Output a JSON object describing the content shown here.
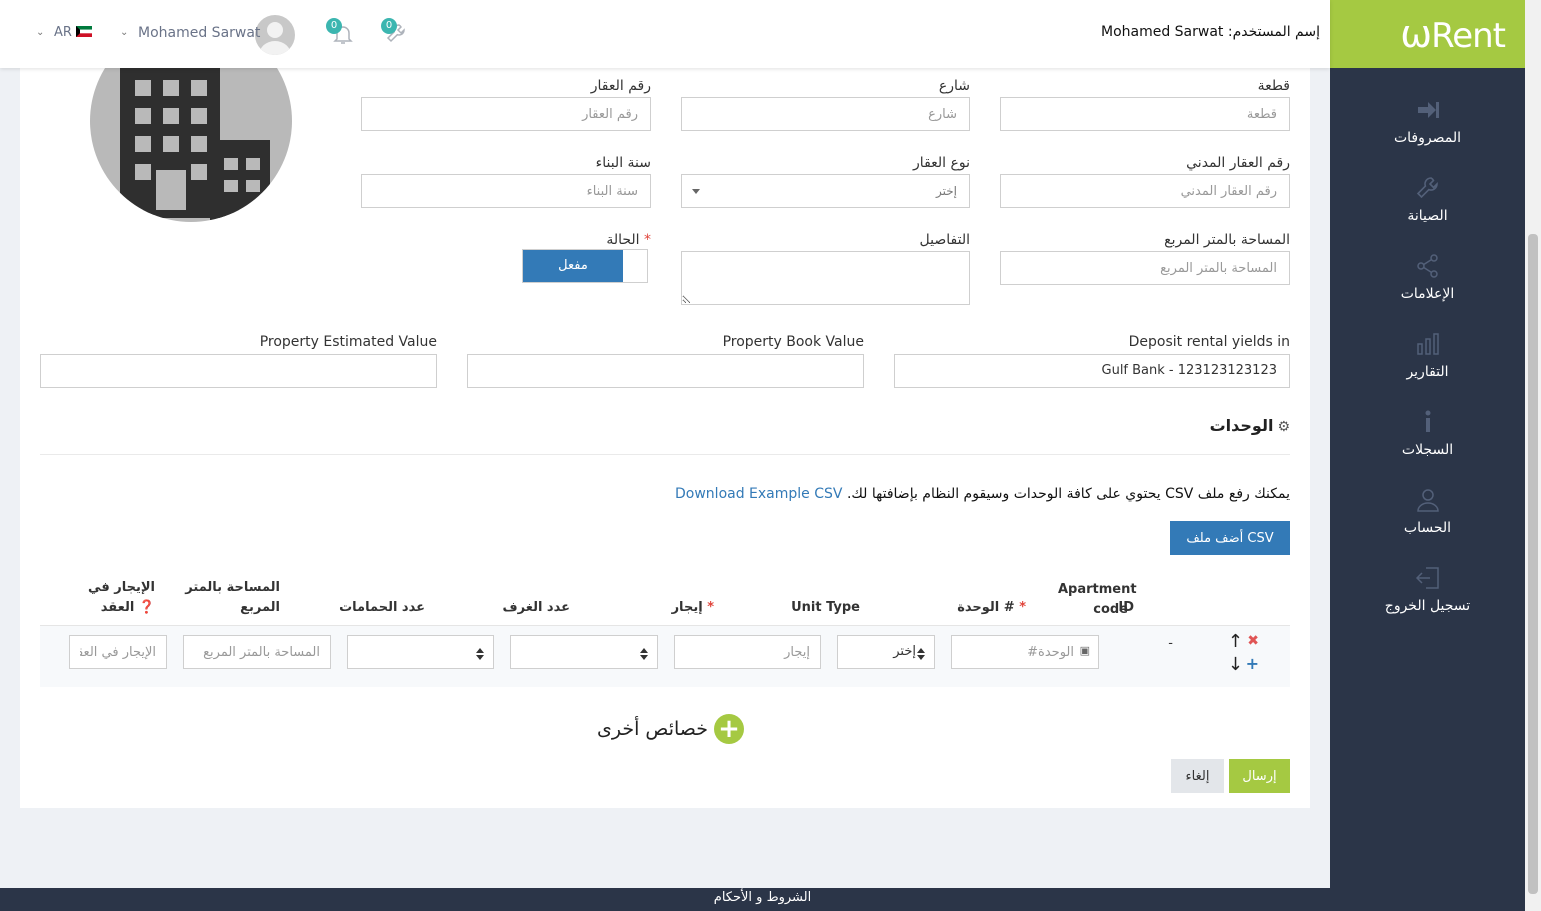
{
  "brand": {
    "name": "Rent",
    "accent_color": "#a5c942",
    "primary_color": "#337ab7",
    "sidebar_color": "#2b3548"
  },
  "header": {
    "username_label": "إسم المستخدم:",
    "username_value": "Mohamed Sarwat",
    "maintenance_count": "0",
    "notifications_count": "0",
    "user_display": "Mohamed Sarwat",
    "language": "AR"
  },
  "sidebar": {
    "items": [
      {
        "label": "المصروفات",
        "icon": "sign-in-icon"
      },
      {
        "label": "الصيانة",
        "icon": "wrench-icon"
      },
      {
        "label": "الإعلامات",
        "icon": "share-icon"
      },
      {
        "label": "التقارير",
        "icon": "bar-chart-icon"
      },
      {
        "label": "السجلات",
        "icon": "info-icon"
      },
      {
        "label": "الحساب",
        "icon": "user-icon"
      },
      {
        "label": "تسجيل الخروج",
        "icon": "sign-out-icon"
      }
    ]
  },
  "form": {
    "block_label": "قطعة",
    "block_placeholder": "قطعة",
    "street_label": "شارع",
    "street_placeholder": "شارع",
    "property_no_label": "رقم العقار",
    "property_no_placeholder": "رقم العقار",
    "civil_no_label": "رقم العقار المدني",
    "civil_no_placeholder": "رقم العقار المدني",
    "property_type_label": "نوع العقار",
    "property_type_value": "إختر",
    "build_year_label": "سنة البناء",
    "build_year_placeholder": "سنة البناء",
    "area_label": "المساحة بالمتر المربع",
    "area_placeholder": "المساحة بالمتر المربع",
    "details_label": "التفاصيل",
    "status_label": "الحالة",
    "required_mark": "*",
    "status_value": "مفعل",
    "deposit_label": "Deposit rental yields in",
    "deposit_value": "Gulf Bank - 123123123123",
    "book_value_label": "Property Book Value",
    "estimated_value_label": "Property Estimated Value"
  },
  "units": {
    "title": "الوحدات",
    "csv_text": "يمكنك رفع ملف CSV يحتوي على كافة الوحدات وسيقوم النظام بإضافتها لك.",
    "csv_link": "Download Example CSV",
    "add_csv_button": "أضف ملف CSV",
    "columns": {
      "id": "ID",
      "apartment_code": "Apartment code",
      "unit_no": "الوحدة #",
      "unit_type": "Unit Type",
      "rent": "إيجار",
      "rooms": "عدد الغرف",
      "bathrooms": "عدد الحمامات",
      "area": "المساحة بالمتر المربع",
      "contract_rent": "الإيجار في العقد"
    },
    "row": {
      "id": "-",
      "unit_placeholder": "الوحدة#",
      "unit_type_value": "إختر",
      "rent_placeholder": "إيجار",
      "area_placeholder": "المساحة بالمتر المربع",
      "contract_rent_placeholder": "الإيجار في العقد"
    },
    "more_features": "خصائص أخرى"
  },
  "actions": {
    "submit": "إرسال",
    "cancel": "إلغاء"
  },
  "footer": {
    "terms": "الشروط و الأحكام"
  }
}
